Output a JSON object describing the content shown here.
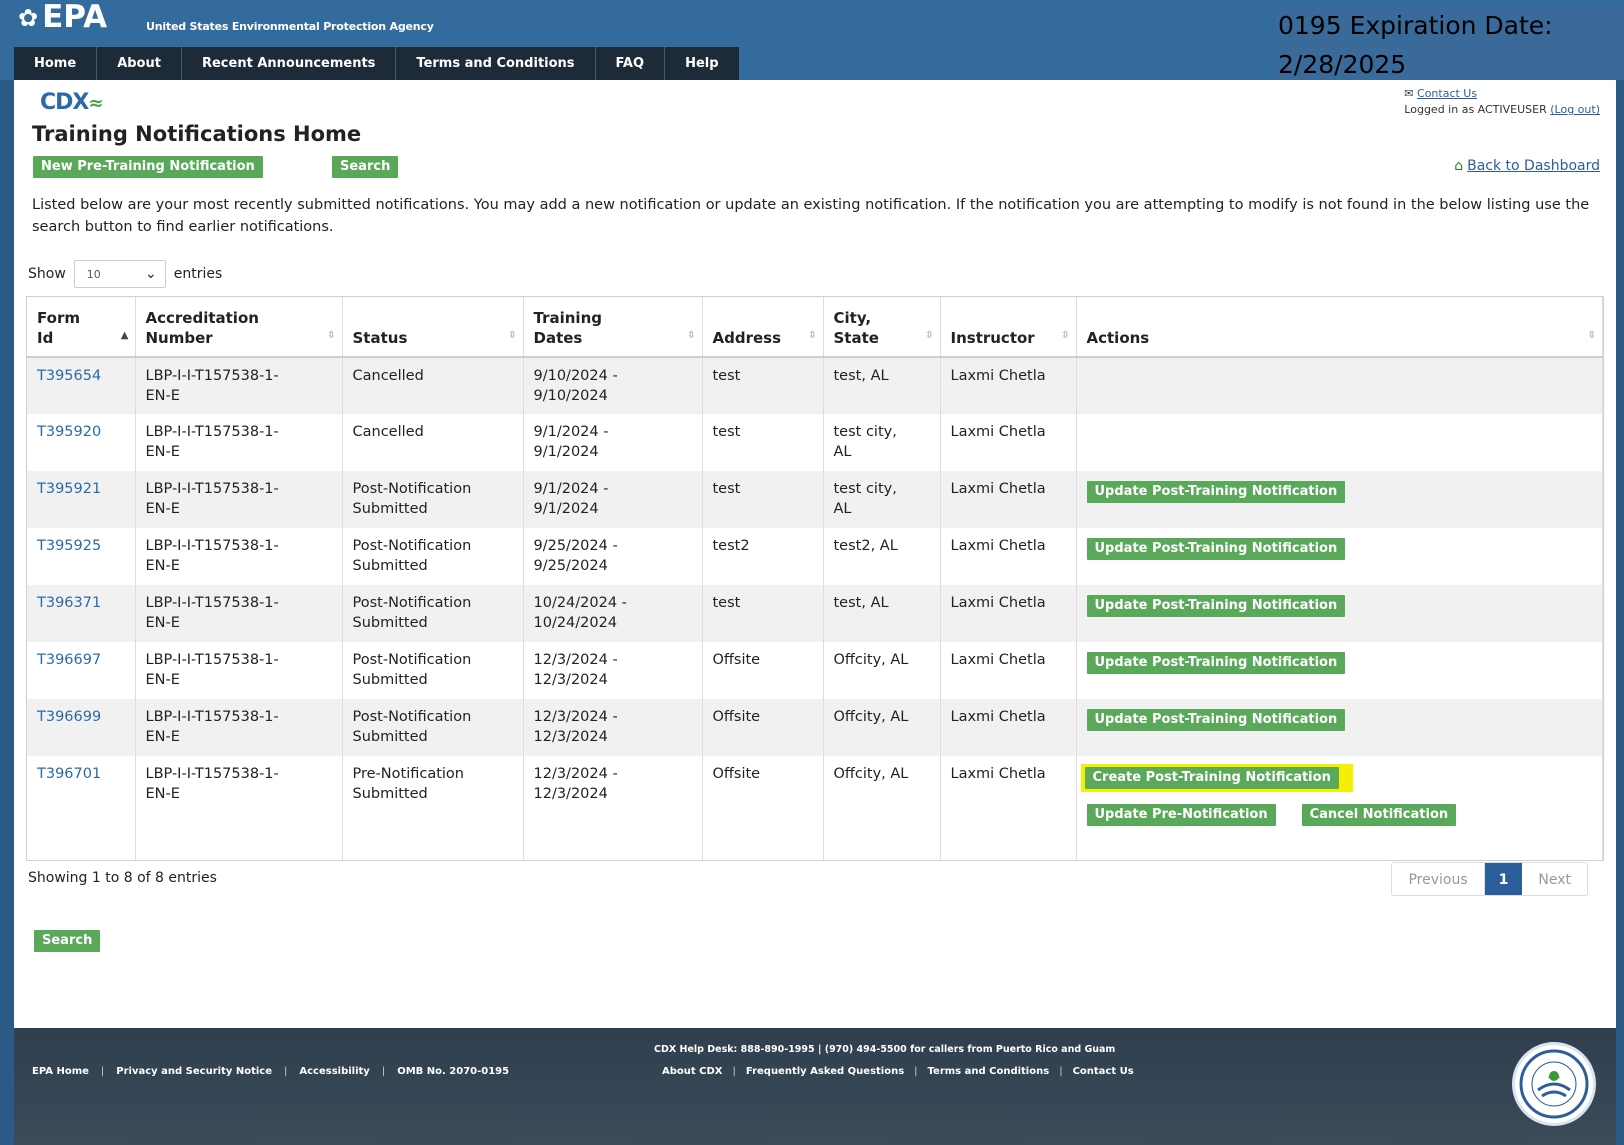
{
  "header": {
    "logo": "EPA",
    "agency": "United States Environmental Protection Agency",
    "omb_line1": "0195 Expiration Date:",
    "omb_line2": "2/28/2025",
    "nav": [
      "Home",
      "About",
      "Recent Announcements",
      "Terms and Conditions",
      "FAQ",
      "Help"
    ]
  },
  "account": {
    "contact": "Contact Us",
    "logged_in": "Logged in as ACTIVEUSER",
    "logout": "(Log out)"
  },
  "cdx_logo": "CDX",
  "page": {
    "title": "Training Notifications Home",
    "new_button": "New Pre-Training Notification",
    "search_button": "Search",
    "back_link": "Back to Dashboard",
    "intro": "Listed below are your most recently submitted notifications. You may add a new notification or update an existing notification. If the notification you are attempting to modify is not found in the below listing use the search button to find earlier notifications.",
    "show_label": "Show",
    "entries_label": "entries",
    "page_size": "10"
  },
  "table": {
    "columns": [
      {
        "line1": "Form",
        "line2": "Id"
      },
      {
        "line1": "Accreditation",
        "line2": "Number"
      },
      {
        "line1": "",
        "line2": "Status"
      },
      {
        "line1": "Training",
        "line2": "Dates"
      },
      {
        "line1": "",
        "line2": "Address"
      },
      {
        "line1": "City,",
        "line2": "State"
      },
      {
        "line1": "",
        "line2": "Instructor"
      },
      {
        "line1": "",
        "line2": "Actions"
      }
    ],
    "rows": [
      {
        "id": "T395654",
        "acc1": "LBP-I-I-T157538-1-",
        "acc2": "EN-E",
        "status1": "Cancelled",
        "status2": "",
        "date1": "9/10/2024 -",
        "date2": "9/10/2024",
        "address": "test",
        "city1": "test, AL",
        "city2": "",
        "instructor": "Laxmi Chetla"
      },
      {
        "id": "T395920",
        "acc1": "LBP-I-I-T157538-1-",
        "acc2": "EN-E",
        "status1": "Cancelled",
        "status2": "",
        "date1": "9/1/2024 -",
        "date2": "9/1/2024",
        "address": "test",
        "city1": "test city,",
        "city2": "AL",
        "instructor": "Laxmi Chetla"
      },
      {
        "id": "T395921",
        "acc1": "LBP-I-I-T157538-1-",
        "acc2": "EN-E",
        "status1": "Post-Notification",
        "status2": "Submitted",
        "date1": "9/1/2024 -",
        "date2": "9/1/2024",
        "address": "test",
        "city1": "test city,",
        "city2": "AL",
        "instructor": "Laxmi Chetla",
        "action": "Update Post-Training Notification"
      },
      {
        "id": "T395925",
        "acc1": "LBP-I-I-T157538-1-",
        "acc2": "EN-E",
        "status1": "Post-Notification",
        "status2": "Submitted",
        "date1": "9/25/2024 -",
        "date2": "9/25/2024",
        "address": "test2",
        "city1": "test2, AL",
        "city2": "",
        "instructor": "Laxmi Chetla",
        "action": "Update Post-Training Notification"
      },
      {
        "id": "T396371",
        "acc1": "LBP-I-I-T157538-1-",
        "acc2": "EN-E",
        "status1": "Post-Notification",
        "status2": "Submitted",
        "date1": "10/24/2024 -",
        "date2": "10/24/2024",
        "address": "test",
        "city1": "test, AL",
        "city2": "",
        "instructor": "Laxmi Chetla",
        "action": "Update Post-Training Notification"
      },
      {
        "id": "T396697",
        "acc1": "LBP-I-I-T157538-1-",
        "acc2": "EN-E",
        "status1": "Post-Notification",
        "status2": "Submitted",
        "date1": "12/3/2024 -",
        "date2": "12/3/2024",
        "address": "Offsite",
        "city1": "Offcity, AL",
        "city2": "",
        "instructor": "Laxmi Chetla",
        "action": "Update Post-Training Notification"
      },
      {
        "id": "T396699",
        "acc1": "LBP-I-I-T157538-1-",
        "acc2": "EN-E",
        "status1": "Post-Notification",
        "status2": "Submitted",
        "date1": "12/3/2024 -",
        "date2": "12/3/2024",
        "address": "Offsite",
        "city1": "Offcity, AL",
        "city2": "",
        "instructor": "Laxmi Chetla",
        "action": "Update Post-Training Notification"
      },
      {
        "id": "T396701",
        "acc1": "LBP-I-I-T157538-1-",
        "acc2": "EN-E",
        "status1": "Pre-Notification",
        "status2": "Submitted",
        "date1": "12/3/2024 -",
        "date2": "12/3/2024",
        "address": "Offsite",
        "city1": "Offcity, AL",
        "city2": "",
        "instructor": "Laxmi Chetla",
        "action_create": "Create Post-Training Notification",
        "action_update_pre": "Update Pre-Notification",
        "action_cancel": "Cancel Notification"
      }
    ]
  },
  "pagination": {
    "showing": "Showing 1 to 8 of 8 entries",
    "previous": "Previous",
    "current": "1",
    "next": "Next"
  },
  "bottom_search": "Search",
  "footer": {
    "left_links": [
      "EPA Home",
      "Privacy and Security Notice",
      "Accessibility",
      "OMB No. 2070-0195"
    ],
    "helpdesk": "CDX Help Desk: 888-890-1995 | (970) 494-5500 for callers from Puerto Rico and Guam",
    "center_links": [
      "About CDX",
      "Frequently Asked Questions",
      "Terms and Conditions",
      "Contact Us"
    ]
  },
  "colors": {
    "header_blue": "#336b9d",
    "nav_dark": "#1d2b39",
    "button_green": "#5aa85a",
    "link_blue": "#2b6ba6",
    "highlight_yellow": "#f4f000"
  }
}
